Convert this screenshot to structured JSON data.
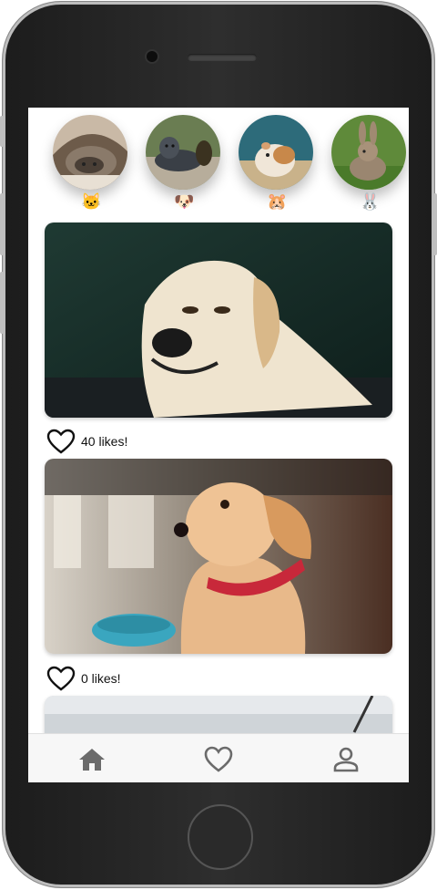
{
  "stories": [
    {
      "animal": "cat",
      "emoji": "🐱"
    },
    {
      "animal": "dog",
      "emoji": "🐶"
    },
    {
      "animal": "hamster",
      "emoji": "🐹"
    },
    {
      "animal": "rabbit",
      "emoji": "🐰"
    }
  ],
  "posts": [
    {
      "image": "labrador-dog-photo",
      "likes_text": "40 likes!"
    },
    {
      "image": "golden-puppy-photo",
      "likes_text": "0 likes!"
    },
    {
      "image": "partial-photo"
    }
  ],
  "nav": {
    "items": [
      {
        "icon": "home-icon"
      },
      {
        "icon": "heart-icon"
      },
      {
        "icon": "profile-icon"
      }
    ]
  },
  "colors": {
    "nav_icon": "#6b6b6b",
    "screen_bg": "#ffffff",
    "frame": "#262626"
  }
}
